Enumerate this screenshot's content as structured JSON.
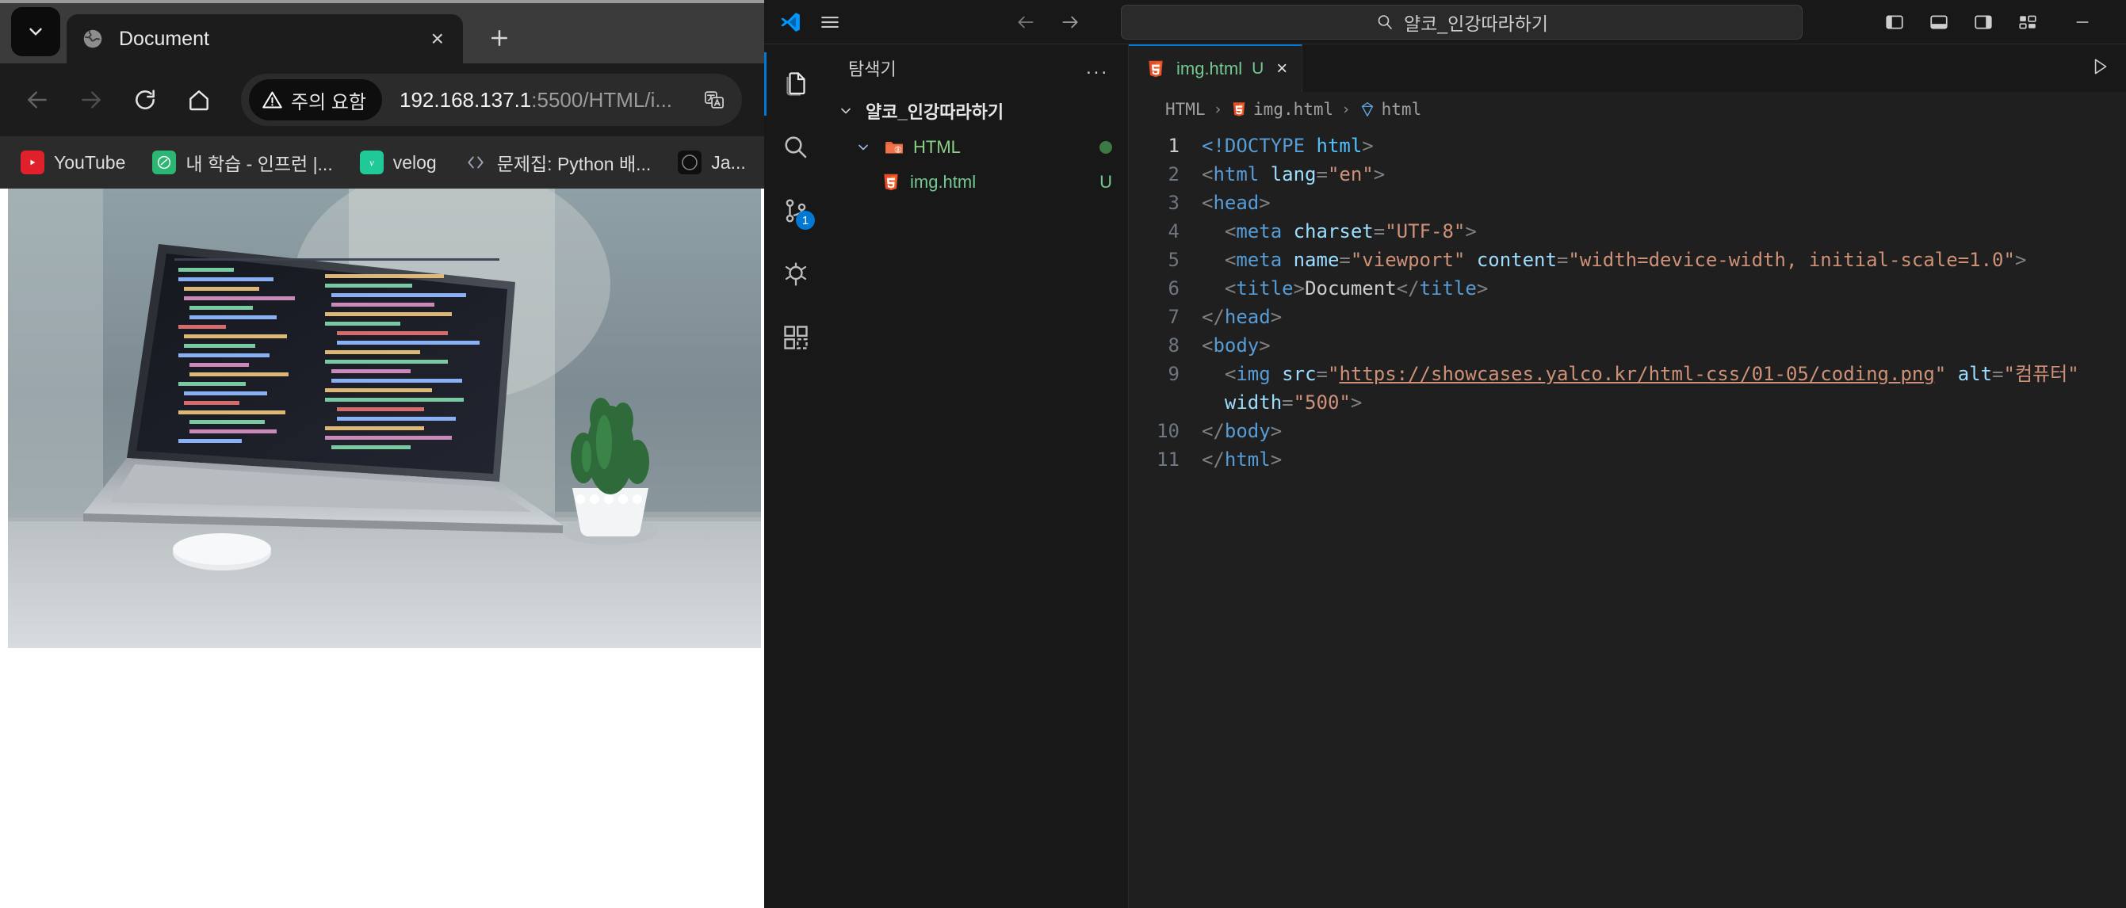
{
  "browser": {
    "tab": {
      "title": "Document",
      "favicon": "globe-icon",
      "close": "×"
    },
    "new_tab": "+",
    "vertical_tabs": "chevron-down-icon",
    "toolbar": {
      "back": "back-arrow-icon",
      "forward": "forward-arrow-icon",
      "reload": "reload-icon",
      "home": "home-icon"
    },
    "address": {
      "warning_label": "주의 요함",
      "warning_icon": "warning-triangle-icon",
      "url_host": "192.168.137.1",
      "url_rest": ":5500/HTML/i...",
      "translate_icon": "translate-icon",
      "full_url": "192.168.137.1:5500/HTML/i..."
    },
    "bookmarks": [
      {
        "label": "YouTube",
        "icon": "youtube-icon",
        "color": "#e0202a"
      },
      {
        "label": "내 학습 - 인프런 |...",
        "icon": "inflearn-icon",
        "color": "#2bb673"
      },
      {
        "label": "velog",
        "icon": "velog-icon",
        "color": "#20c997"
      },
      {
        "label": "문제집: Python 배...",
        "icon": "code-brackets-icon",
        "color": "#9aa4b0"
      },
      {
        "label": "Ja...",
        "icon": "javascript-icon",
        "color": "#0f0f0f"
      }
    ],
    "page": {
      "image_alt": "컴퓨터",
      "image_desc": "laptop-photo"
    }
  },
  "vscode": {
    "titlebar": {
      "logo": "vscode-logo-icon",
      "menu": "hamburger-menu-icon",
      "back": "back-arrow-icon",
      "forward": "forward-arrow-icon",
      "search_value": "얄코_인강따라하기",
      "search_icon": "search-icon",
      "layout_icons": [
        "toggle-primary-sidebar-icon",
        "toggle-panel-icon",
        "toggle-secondary-sidebar-icon",
        "customize-layout-icon"
      ],
      "minimize": "minimize-icon"
    },
    "activitybar": [
      {
        "name": "explorer",
        "icon": "files-icon",
        "active": true,
        "badge": null
      },
      {
        "name": "search",
        "icon": "search-icon",
        "active": false,
        "badge": null
      },
      {
        "name": "source-control",
        "icon": "source-control-icon",
        "active": false,
        "badge": "1"
      },
      {
        "name": "run-and-debug",
        "icon": "run-debug-icon",
        "active": false,
        "badge": null
      },
      {
        "name": "extensions",
        "icon": "extensions-icon",
        "active": false,
        "badge": null
      }
    ],
    "explorer": {
      "title": "탐색기",
      "more_actions": "...",
      "root": {
        "label": "얄코_인강따라하기",
        "expanded": true
      },
      "tree": [
        {
          "label": "HTML",
          "type": "folder",
          "expanded": true,
          "status": "dot",
          "indent": 1
        },
        {
          "label": "img.html",
          "type": "html-file",
          "status": "U",
          "indent": 2
        }
      ]
    },
    "editor": {
      "tab": {
        "label": "img.html",
        "status": "U",
        "close": "×",
        "icon": "html5-icon"
      },
      "run_icon": "run-play-icon",
      "breadcrumb": [
        {
          "label": "HTML",
          "icon": null
        },
        {
          "label": "img.html",
          "icon": "html5-icon"
        },
        {
          "label": "html",
          "icon": "symbol-element-icon"
        }
      ],
      "lines": [
        {
          "n": "1",
          "tokens": [
            {
              "t": "<!DOCTYPE ",
              "c": "punct-doctype"
            },
            {
              "t": "html",
              "c": "dt-name"
            },
            {
              "t": ">",
              "c": "punct"
            }
          ]
        },
        {
          "n": "2",
          "tokens": [
            {
              "t": "<",
              "c": "punct"
            },
            {
              "t": "html",
              "c": "tag"
            },
            {
              "t": " ",
              "c": "text"
            },
            {
              "t": "lang",
              "c": "attr"
            },
            {
              "t": "=",
              "c": "punct"
            },
            {
              "t": "\"en\"",
              "c": "str"
            },
            {
              "t": ">",
              "c": "punct"
            }
          ]
        },
        {
          "n": "3",
          "tokens": [
            {
              "t": "<",
              "c": "punct"
            },
            {
              "t": "head",
              "c": "tag"
            },
            {
              "t": ">",
              "c": "punct"
            }
          ]
        },
        {
          "n": "4",
          "tokens": [
            {
              "t": "  <",
              "c": "punct"
            },
            {
              "t": "meta",
              "c": "tag"
            },
            {
              "t": " ",
              "c": "text"
            },
            {
              "t": "charset",
              "c": "attr"
            },
            {
              "t": "=",
              "c": "punct"
            },
            {
              "t": "\"UTF-8\"",
              "c": "str"
            },
            {
              "t": ">",
              "c": "punct"
            }
          ]
        },
        {
          "n": "5",
          "tokens": [
            {
              "t": "  <",
              "c": "punct"
            },
            {
              "t": "meta",
              "c": "tag"
            },
            {
              "t": " ",
              "c": "text"
            },
            {
              "t": "name",
              "c": "attr"
            },
            {
              "t": "=",
              "c": "punct"
            },
            {
              "t": "\"viewport\"",
              "c": "str"
            },
            {
              "t": " ",
              "c": "text"
            },
            {
              "t": "content",
              "c": "attr"
            },
            {
              "t": "=",
              "c": "punct"
            },
            {
              "t": "\"width=device-width, initial-scale=1.0\"",
              "c": "str"
            },
            {
              "t": ">",
              "c": "punct"
            }
          ]
        },
        {
          "n": "6",
          "tokens": [
            {
              "t": "  <",
              "c": "punct"
            },
            {
              "t": "title",
              "c": "tag"
            },
            {
              "t": ">",
              "c": "punct"
            },
            {
              "t": "Document",
              "c": "text"
            },
            {
              "t": "</",
              "c": "punct"
            },
            {
              "t": "title",
              "c": "tag"
            },
            {
              "t": ">",
              "c": "punct"
            }
          ]
        },
        {
          "n": "7",
          "tokens": [
            {
              "t": "</",
              "c": "punct"
            },
            {
              "t": "head",
              "c": "tag"
            },
            {
              "t": ">",
              "c": "punct"
            }
          ]
        },
        {
          "n": "8",
          "tokens": [
            {
              "t": "<",
              "c": "punct"
            },
            {
              "t": "body",
              "c": "tag"
            },
            {
              "t": ">",
              "c": "punct"
            }
          ]
        },
        {
          "n": "9",
          "tokens": [
            {
              "t": "  <",
              "c": "punct"
            },
            {
              "t": "img",
              "c": "tag"
            },
            {
              "t": " ",
              "c": "text"
            },
            {
              "t": "src",
              "c": "attr"
            },
            {
              "t": "=",
              "c": "punct"
            },
            {
              "t": "\"",
              "c": "str"
            },
            {
              "t": "https://showcases.yalco.kr/html-css/01-05/coding.png",
              "c": "link"
            },
            {
              "t": "\"",
              "c": "str"
            },
            {
              "t": " ",
              "c": "text"
            },
            {
              "t": "alt",
              "c": "attr"
            },
            {
              "t": "=",
              "c": "punct"
            },
            {
              "t": "\"컴퓨터\"",
              "c": "str"
            }
          ]
        },
        {
          "n": "",
          "tokens": [
            {
              "t": "  ",
              "c": "text"
            },
            {
              "t": "width",
              "c": "attr"
            },
            {
              "t": "=",
              "c": "punct"
            },
            {
              "t": "\"500\"",
              "c": "str"
            },
            {
              "t": ">",
              "c": "punct"
            }
          ]
        },
        {
          "n": "10",
          "tokens": [
            {
              "t": "</",
              "c": "punct"
            },
            {
              "t": "body",
              "c": "tag"
            },
            {
              "t": ">",
              "c": "punct"
            }
          ]
        },
        {
          "n": "11",
          "tokens": [
            {
              "t": "</",
              "c": "punct"
            },
            {
              "t": "html",
              "c": "tag"
            },
            {
              "t": ">",
              "c": "punct"
            }
          ]
        }
      ]
    }
  },
  "colors": {
    "accent": "#0078d4",
    "html_orange": "#e44d26",
    "green_text": "#73c991",
    "string": "#ce9178",
    "tag": "#569cd6",
    "attr": "#9cdcfe"
  }
}
